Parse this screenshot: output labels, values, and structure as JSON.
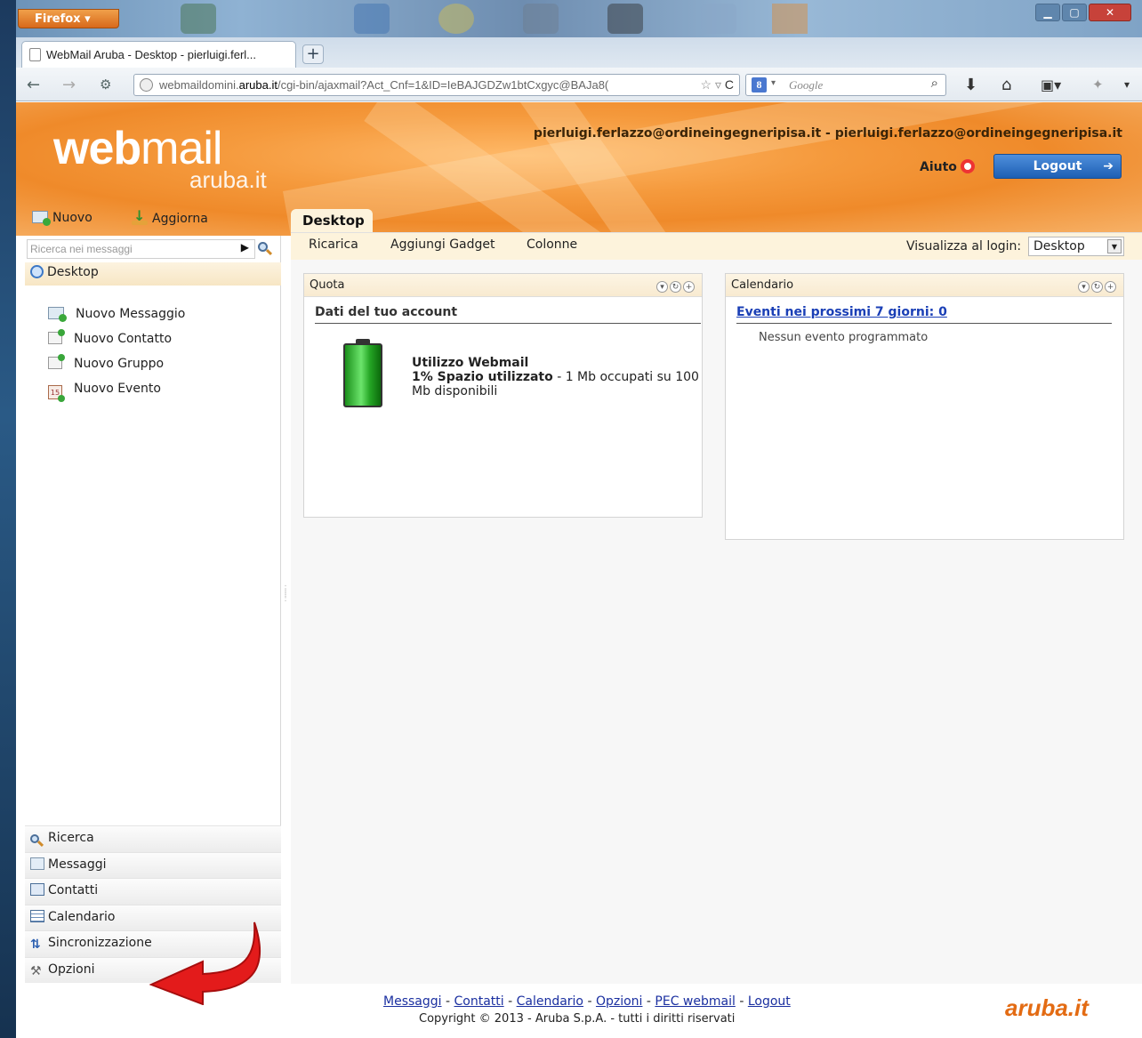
{
  "browser": {
    "menu_button": "Firefox",
    "tab_title": "WebMail Aruba - Desktop - pierluigi.ferl...",
    "new_tab": "+",
    "url_prefix": "webmaildomini.",
    "url_domain": "aruba.it",
    "url_path": "/cgi-bin/ajaxmail?Act_Cnf=1&ID=IeBAJGDZw1btCxgyc@BAJa8(",
    "search_engine": "8",
    "search_placeholder": "Google",
    "icons": [
      "back-arrow-icon",
      "forward-arrow-icon",
      "history-icon",
      "star-icon",
      "reload-icon",
      "download-icon",
      "home-icon",
      "addon-icon",
      "menu-icon"
    ]
  },
  "header": {
    "logo_web": "web",
    "logo_mail": "mail",
    "logo_sub": "aruba.it",
    "user": "pierluigi.ferlazzo@ordineingegneripisa.it - pierluigi.ferlazzo@ordineingegneripisa.it",
    "help": "Aiuto",
    "logout": "Logout",
    "accent": "#f0902f",
    "button_color": "#2a6cc4"
  },
  "toolbar": {
    "new": "Nuovo",
    "refresh": "Aggiorna"
  },
  "main_tab": "Desktop",
  "sidebar": {
    "search_placeholder": "Ricerca nei messaggi",
    "desktop": "Desktop",
    "quick_items": [
      "Nuovo Messaggio",
      "Nuovo Contatto",
      "Nuovo Gruppo",
      "Nuovo Evento"
    ],
    "sections": [
      "Ricerca",
      "Messaggi",
      "Contatti",
      "Calendario",
      "Sincronizzazione",
      "Opzioni"
    ]
  },
  "subtoolbar": {
    "reload": "Ricarica",
    "add_gadget": "Aggiungi Gadget",
    "columns": "Colonne",
    "view_login_label": "Visualizza al login:",
    "view_login_value": "Desktop"
  },
  "quota": {
    "title": "Quota",
    "subtitle": "Dati del tuo account",
    "usage_title": "Utilizzo Webmail",
    "usage_bold": "1% Spazio utilizzato",
    "usage_detail": " - 1 Mb occupati su 100 Mb disponibili",
    "used_percent": 1
  },
  "calendar": {
    "title": "Calendario",
    "events_link": "Eventi nei prossimi 7 giorni: 0",
    "empty": "Nessun evento programmato"
  },
  "footer": {
    "links": [
      "Messaggi",
      "Contatti",
      "Calendario",
      "Opzioni",
      "PEC webmail",
      "Logout"
    ],
    "separator": " - ",
    "copyright": "Copyright © 2013 - Aruba S.p.A. - tutti i diritti riservati",
    "logo": "aruba.it"
  }
}
